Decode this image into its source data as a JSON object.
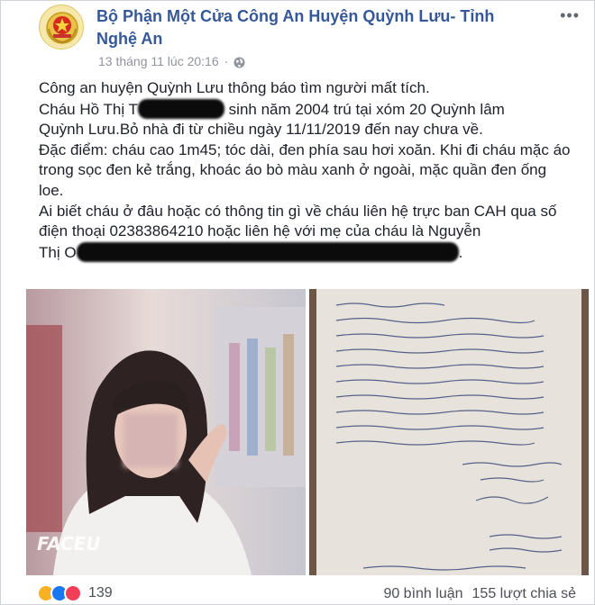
{
  "post": {
    "page_name": "Bộ Phận Một Cửa Công An Huyện Quỳnh Lưu- Tỉnh Nghệ An",
    "timestamp": "13 tháng 11 lúc 20:16",
    "separator": "·",
    "privacy_icon": "globe-icon",
    "more_icon": "more-options-icon",
    "text": {
      "line1": "Công an huyện Quỳnh Lưu thông báo tìm người mất tích.",
      "line2a": "Cháu Hồ Thị T",
      "line2b": " sinh năm 2004 trú tại xóm 20 Quỳnh lâm",
      "line3": "Quỳnh Lưu.Bỏ nhà đi từ chiều ngày 11/11/2019 đến nay chưa về.",
      "line4": "Đặc điểm: cháu cao 1m45; tóc dài, đen phía sau hơi xoăn. Khi đi cháu mặc áo trong sọc đen kẻ trắng, khoác áo bò màu xanh ở ngoài, mặc quần đen ống loe.",
      "line5": "Ai biết cháu ở đâu hoặc có thông tin gì về cháu liên hệ trực ban CAH qua số điện thoại 02383864210 hoặc liên hệ với mẹ của cháu là Nguyễn",
      "line6a": "Thị O",
      "line6b": "."
    }
  },
  "photos": {
    "left_watermark": "FACEU"
  },
  "footer": {
    "reaction_count": "139",
    "comments": "90 bình luận",
    "shares": "155 lượt chia sẻ",
    "reactions": [
      "haha-icon",
      "like-icon",
      "love-icon"
    ]
  },
  "colors": {
    "link_blue": "#365899",
    "meta_gray": "#90949c",
    "like_blue": "#1877f2",
    "love_red": "#f33e58",
    "haha_yellow": "#f7b125"
  }
}
